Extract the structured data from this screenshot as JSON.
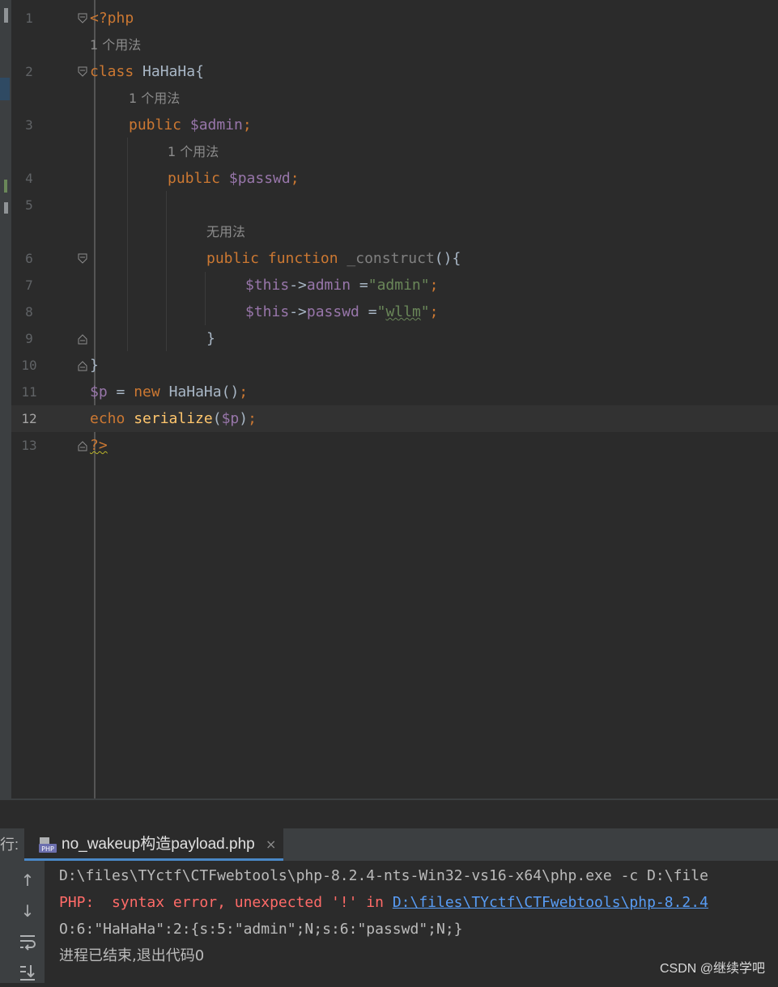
{
  "editor": {
    "lines": [
      {
        "num": "1",
        "code": "<?php"
      },
      {
        "num": "2",
        "code": "class HaHaHa{"
      },
      {
        "num": "3",
        "code": "public $admin;"
      },
      {
        "num": "4",
        "code": "public $passwd;"
      },
      {
        "num": "5",
        "code": ""
      },
      {
        "num": "6",
        "code": "public function _construct(){"
      },
      {
        "num": "7",
        "code": "$this->admin =\"admin\";"
      },
      {
        "num": "8",
        "code": "$this->passwd =\"wllm\";"
      },
      {
        "num": "9",
        "code": "}"
      },
      {
        "num": "10",
        "code": "}"
      },
      {
        "num": "11",
        "code": "$p = new HaHaHa();"
      },
      {
        "num": "12",
        "code": "echo serialize($p);"
      },
      {
        "num": "13",
        "code": "?>"
      }
    ],
    "hints": {
      "usage_1": "1 个用法",
      "usage_2": "1 个用法",
      "usage_3": "1 个用法",
      "no_usage": "无用法"
    },
    "tokens": {
      "php_open": "<?php",
      "kw_class": "class",
      "class_name": "HaHaHa",
      "lbrace": "{",
      "kw_public": "public",
      "var_admin": "$admin",
      "var_passwd": "$passwd",
      "semi": ";",
      "kw_function": "function",
      "fn_construct": "_construct",
      "parens_brace": "(){",
      "this": "$this",
      "arrow": "->",
      "prop_admin": "admin",
      "prop_passwd": "passwd",
      "assign": " =",
      "str_admin": "\"admin\"",
      "str_wllm_q1": "\"",
      "str_wllm_body": "wllm",
      "str_wllm_q2": "\"",
      "rbrace": "}",
      "var_p": "$p",
      "eq": " = ",
      "kw_new": "new",
      "call_open": "(",
      "call_close": ")",
      "kw_echo": "echo",
      "fn_serialize": "serialize",
      "php_close": "?>"
    },
    "current_line": "12"
  },
  "run_panel": {
    "label": "行:",
    "tab_title": "no_wakeup构造payload.php",
    "tab_icon": "php-file-icon",
    "close_glyph": "×"
  },
  "console": {
    "line1": "D:\\files\\TYctf\\CTFwebtools\\php-8.2.4-nts-Win32-vs16-x64\\php.exe -c D:\\file",
    "line2_prefix": "PHP:  syntax error, unexpected '!' in ",
    "line2_link": "D:\\files\\TYctf\\CTFwebtools\\php-8.2.4",
    "line3": "O:6:\"HaHaHa\":2:{s:5:\"admin\";N;s:6:\"passwd\";N;}",
    "line4": "进程已结束,退出代码0"
  },
  "watermark": "CSDN @继续学吧",
  "colors": {
    "background": "#2b2b2b",
    "keyword": "#cc7832",
    "variable": "#9876aa",
    "string": "#6a8759",
    "function": "#ffc66d",
    "error": "#ff6b68",
    "link": "#589df6"
  }
}
